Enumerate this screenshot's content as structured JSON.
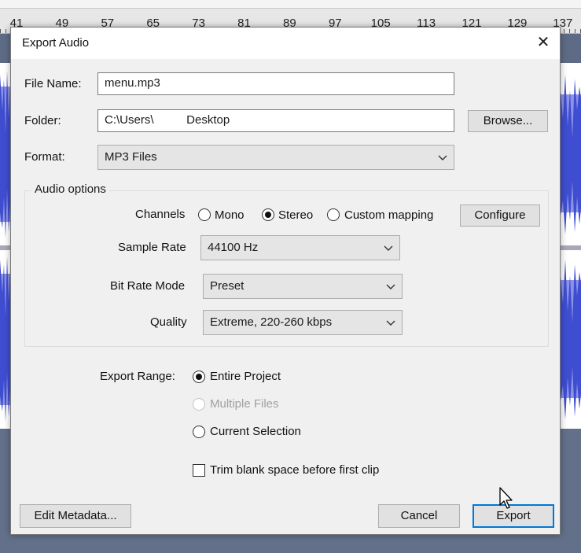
{
  "ruler": {
    "labels": [
      "41",
      "49",
      "57",
      "65",
      "73",
      "81",
      "89",
      "97",
      "105",
      "113",
      "121",
      "129",
      "137"
    ]
  },
  "dialog": {
    "title": "Export Audio",
    "close_icon": "close-icon",
    "file_name": {
      "label": "File Name:",
      "value": "menu.mp3"
    },
    "folder": {
      "label": "Folder:",
      "value": "C:\\Users\\          Desktop",
      "browse_label": "Browse..."
    },
    "format": {
      "label": "Format:",
      "value": "MP3 Files"
    },
    "audio_options": {
      "title": "Audio options",
      "channels": {
        "label": "Channels",
        "options": [
          "Mono",
          "Stereo",
          "Custom mapping"
        ],
        "selected": "Stereo",
        "configure_label": "Configure"
      },
      "sample_rate": {
        "label": "Sample Rate",
        "value": "44100 Hz"
      },
      "bit_rate_mode": {
        "label": "Bit Rate Mode",
        "value": "Preset"
      },
      "quality": {
        "label": "Quality",
        "value": "Extreme, 220-260 kbps"
      }
    },
    "export_range": {
      "label": "Export Range:",
      "options": [
        "Entire Project",
        "Multiple Files",
        "Current Selection"
      ],
      "selected": "Entire Project",
      "disabled": [
        "Multiple Files"
      ]
    },
    "trim_checkbox": {
      "label": "Trim blank space before first clip",
      "checked": false
    },
    "buttons": {
      "edit_metadata": "Edit Metadata...",
      "cancel": "Cancel",
      "export": "Export"
    }
  },
  "colors": {
    "waveform": "#3f4dd1",
    "waveform_light": "#8c93e6",
    "default_button_border": "#0078d7"
  }
}
